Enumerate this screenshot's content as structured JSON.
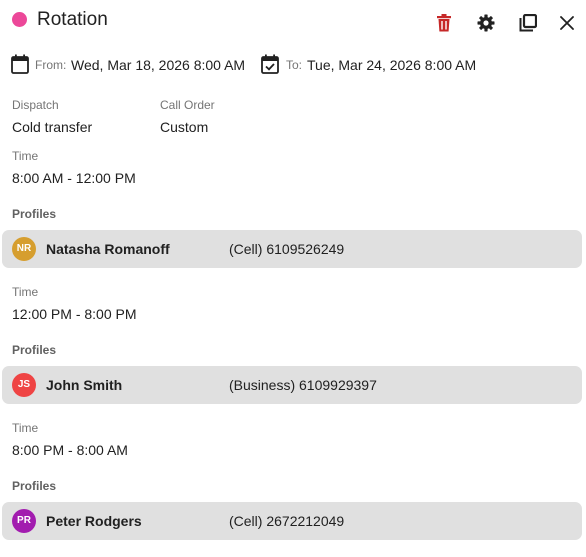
{
  "header": {
    "title": "Rotation",
    "dot_color": "#ec4899",
    "icons": [
      "delete-icon",
      "gear-icon",
      "duplicate-icon",
      "close-icon"
    ]
  },
  "dates": {
    "from_label": "From:",
    "from_value": "Wed, Mar 18, 2026 8:00 AM",
    "to_label": "To:",
    "to_value": "Tue, Mar 24, 2026 8:00 AM"
  },
  "details": {
    "dispatch_label": "Dispatch",
    "dispatch_value": "Cold transfer",
    "call_order_label": "Call Order",
    "call_order_value": "Custom"
  },
  "shifts": [
    {
      "time_label": "Time",
      "time_value": "8:00 AM - 12:00 PM",
      "profiles_label": "Profiles",
      "profile": {
        "initials": "NR",
        "name": "Natasha Romanoff",
        "phone": "(Cell) 6109526249",
        "avatar_color": "#d69e2e"
      }
    },
    {
      "time_label": "Time",
      "time_value": "12:00 PM - 8:00 PM",
      "profiles_label": "Profiles",
      "profile": {
        "initials": "JS",
        "name": "John Smith",
        "phone": "(Business) 6109929397",
        "avatar_color": "#ef4444"
      }
    },
    {
      "time_label": "Time",
      "time_value": "8:00 PM - 8:00 AM",
      "profiles_label": "Profiles",
      "profile": {
        "initials": "PR",
        "name": "Peter Rodgers",
        "phone": "(Cell) 2672212049",
        "avatar_color": "#a21caf"
      }
    }
  ],
  "colors": {
    "delete": "#c62828",
    "icon": "#212121",
    "row_bg": "#e0e0e0"
  }
}
